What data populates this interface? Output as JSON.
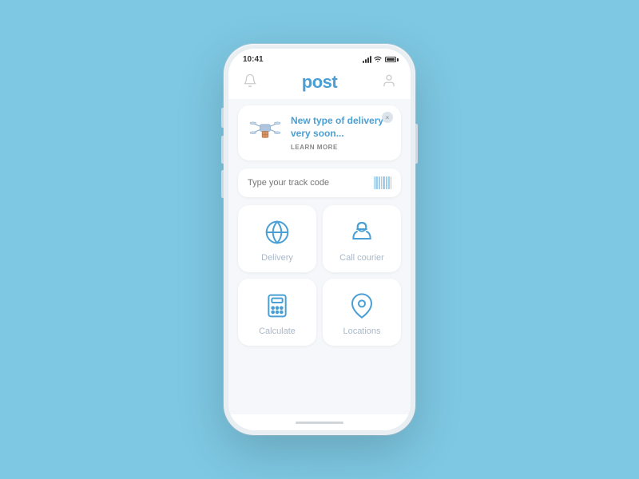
{
  "statusBar": {
    "time": "10:41"
  },
  "header": {
    "logo": "post",
    "bellLabel": "notifications",
    "userLabel": "profile"
  },
  "banner": {
    "title": "New type of delivery very soon...",
    "learnMore": "LEARN MORE",
    "closeLabel": "×",
    "emoji": "📦"
  },
  "trackInput": {
    "placeholder": "Type your track code"
  },
  "actions": [
    {
      "id": "delivery",
      "label": "Delivery",
      "icon": "globe"
    },
    {
      "id": "call-courier",
      "label": "Call courier",
      "icon": "courier"
    },
    {
      "id": "calculate",
      "label": "Calculate",
      "icon": "calculator"
    },
    {
      "id": "locations",
      "label": "Locations",
      "icon": "pin"
    }
  ],
  "colors": {
    "accent": "#4a9fd4",
    "background": "#7ec8e3",
    "cardBg": "#ffffff",
    "textMuted": "#aab8c8"
  }
}
